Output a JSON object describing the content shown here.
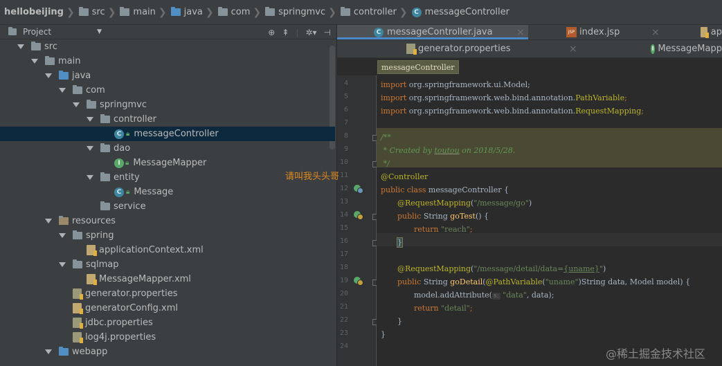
{
  "breadcrumb": [
    {
      "label": "hellobeijing",
      "icon": "folder-icon",
      "bold": true
    },
    {
      "label": "src",
      "icon": "folder-icon"
    },
    {
      "label": "main",
      "icon": "folder-icon"
    },
    {
      "label": "java",
      "icon": "folder-icon"
    },
    {
      "label": "com",
      "icon": "folder-icon"
    },
    {
      "label": "springmvc",
      "icon": "folder-icon"
    },
    {
      "label": "controller",
      "icon": "folder-icon"
    },
    {
      "label": "messageController",
      "icon": "class-icon"
    }
  ],
  "project": {
    "title": "Project",
    "tree": [
      {
        "label": "src",
        "kind": "folder",
        "expanded": true
      },
      {
        "label": "main",
        "kind": "folder",
        "expanded": true
      },
      {
        "label": "java",
        "kind": "folder-blue",
        "expanded": true
      },
      {
        "label": "com",
        "kind": "folder",
        "expanded": true
      },
      {
        "label": "springmvc",
        "kind": "folder",
        "expanded": true
      },
      {
        "label": "controller",
        "kind": "folder",
        "expanded": true
      },
      {
        "label": "messageController",
        "kind": "class",
        "selected": true
      },
      {
        "label": "dao",
        "kind": "folder",
        "expanded": true
      },
      {
        "label": "MessageMapper",
        "kind": "interface"
      },
      {
        "label": "entity",
        "kind": "folder",
        "expanded": true
      },
      {
        "label": "Message",
        "kind": "class"
      },
      {
        "label": "service",
        "kind": "folder"
      },
      {
        "label": "resources",
        "kind": "folder",
        "expanded": true
      },
      {
        "label": "spring",
        "kind": "folder",
        "expanded": true
      },
      {
        "label": "applicationContext.xml",
        "kind": "xml"
      },
      {
        "label": "sqlmap",
        "kind": "folder",
        "expanded": true
      },
      {
        "label": "MessageMapper.xml",
        "kind": "xml"
      },
      {
        "label": "generator.properties",
        "kind": "properties"
      },
      {
        "label": "generatorConfig.xml",
        "kind": "xml"
      },
      {
        "label": "jdbc.properties",
        "kind": "properties"
      },
      {
        "label": "log4j.properties",
        "kind": "properties"
      },
      {
        "label": "webapp",
        "kind": "folder",
        "expanded": true
      }
    ]
  },
  "tabs": {
    "row1": [
      {
        "label": "messageController.java",
        "icon": "class-icon",
        "active": true
      },
      {
        "label": "index.jsp",
        "icon": "jsp-icon"
      },
      {
        "label": "ap",
        "icon": "xml-icon"
      }
    ],
    "row2": [
      {
        "label": "generator.properties",
        "icon": "properties-icon"
      },
      {
        "label": "MessageMapp",
        "icon": "interface-icon"
      }
    ]
  },
  "editor": {
    "breadcrumb": "messageController",
    "line_numbers": [
      "4",
      "5",
      "6",
      "7",
      "8",
      "9",
      "10",
      "11",
      "12",
      "13",
      "14",
      "15",
      "16",
      "17",
      "18",
      "19",
      "20",
      "21",
      "22",
      "23",
      "24"
    ],
    "code": {
      "l4_kw": "import",
      "l4_rest": " org.springframework.ui.Model;",
      "l5_kw": "import",
      "l5_rest": " org.springframework.web.bind.annotation.",
      "l5_cls": "PathVariable",
      "l5_end": ";",
      "l6_kw": "import",
      "l6_rest": " org.springframework.web.bind.annotation.",
      "l6_cls": "RequestMapping",
      "l6_end": ";",
      "l8": "/**",
      "l9_a": " * Created by ",
      "l9_u": "toutou",
      "l9_b": " on 2018/5/28.",
      "l10": " */",
      "l11": "@Controller",
      "l12_kw": "public class",
      "l12_rest": " messageController {",
      "l13_ann": "@RequestMapping",
      "l13_p1": "(",
      "l13_str": "\"/message/go\"",
      "l13_p2": ")",
      "l14_kw": "public",
      "l14_rest": " String ",
      "l14_fn": "goTest",
      "l14_end": "() {",
      "l15_kw": "return",
      "l15_str": " \"reach\"",
      "l15_end": ";",
      "l16": "}",
      "l18_ann": "@RequestMapping",
      "l18_p1": "(",
      "l18_str1": "\"/message/detail/data=",
      "l18_u": "{uname}",
      "l18_str2": "\"",
      "l18_p2": ")",
      "l19_kw": "public",
      "l19_rest1": " String ",
      "l19_fn": "goDetail",
      "l19_p": "(",
      "l19_ann": "@PathVariable",
      "l19_p2": "(",
      "l19_str": "\"uname\"",
      "l19_rest2": ")String data, Model model) {",
      "l20_a": "model.addAttribute(",
      "l20_hint": "s:",
      "l20_str": " \"data\"",
      "l20_b": ", data);",
      "l21_kw": "return",
      "l21_str": " \"detail\"",
      "l21_end": ";",
      "l22": "}",
      "l23": "}"
    }
  },
  "overlay_text": "请叫我头头哥",
  "watermark": "@稀土掘金技术社区"
}
